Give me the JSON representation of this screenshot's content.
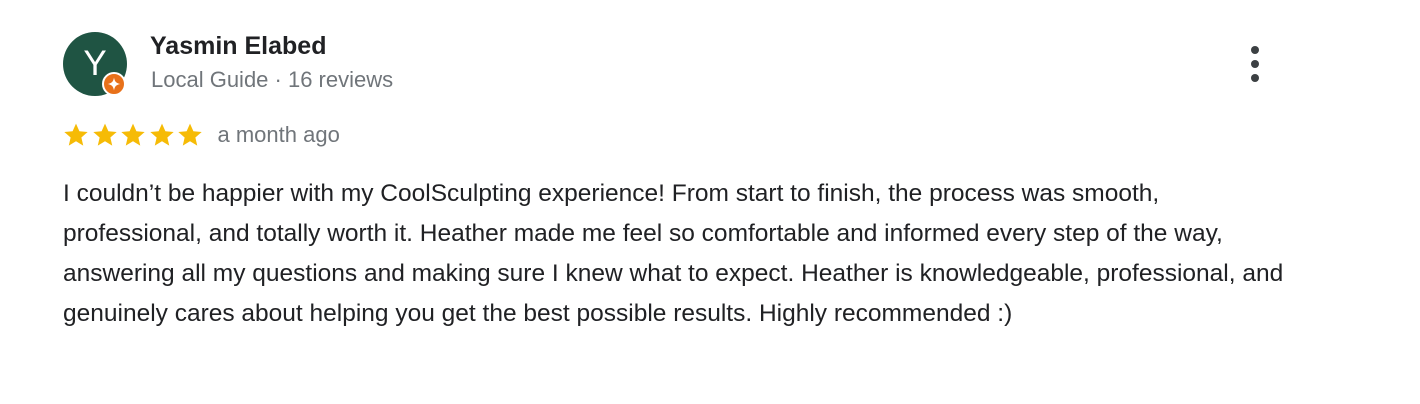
{
  "reviewer": {
    "avatar_initial": "Y",
    "avatar_color": "#1f5443",
    "badge_color": "#e8711a",
    "name": "Yasmin Elabed",
    "meta": "Local Guide · 16 reviews"
  },
  "rating": {
    "stars": 5,
    "max_stars": 5,
    "star_color": "#f6bb06",
    "date": "a month ago"
  },
  "review": {
    "text": "I couldn’t be happier with my CoolSculpting experience! From start to finish, the process was smooth, professional, and totally worth it. Heather made me feel so comfortable and informed every step of the way, answering all my questions and making sure I knew what to expect. Heather is knowledgeable, professional, and genuinely cares about helping you get the best possible results. Highly recommended :)"
  },
  "actions": {
    "more_icon": "more-vert-icon"
  }
}
